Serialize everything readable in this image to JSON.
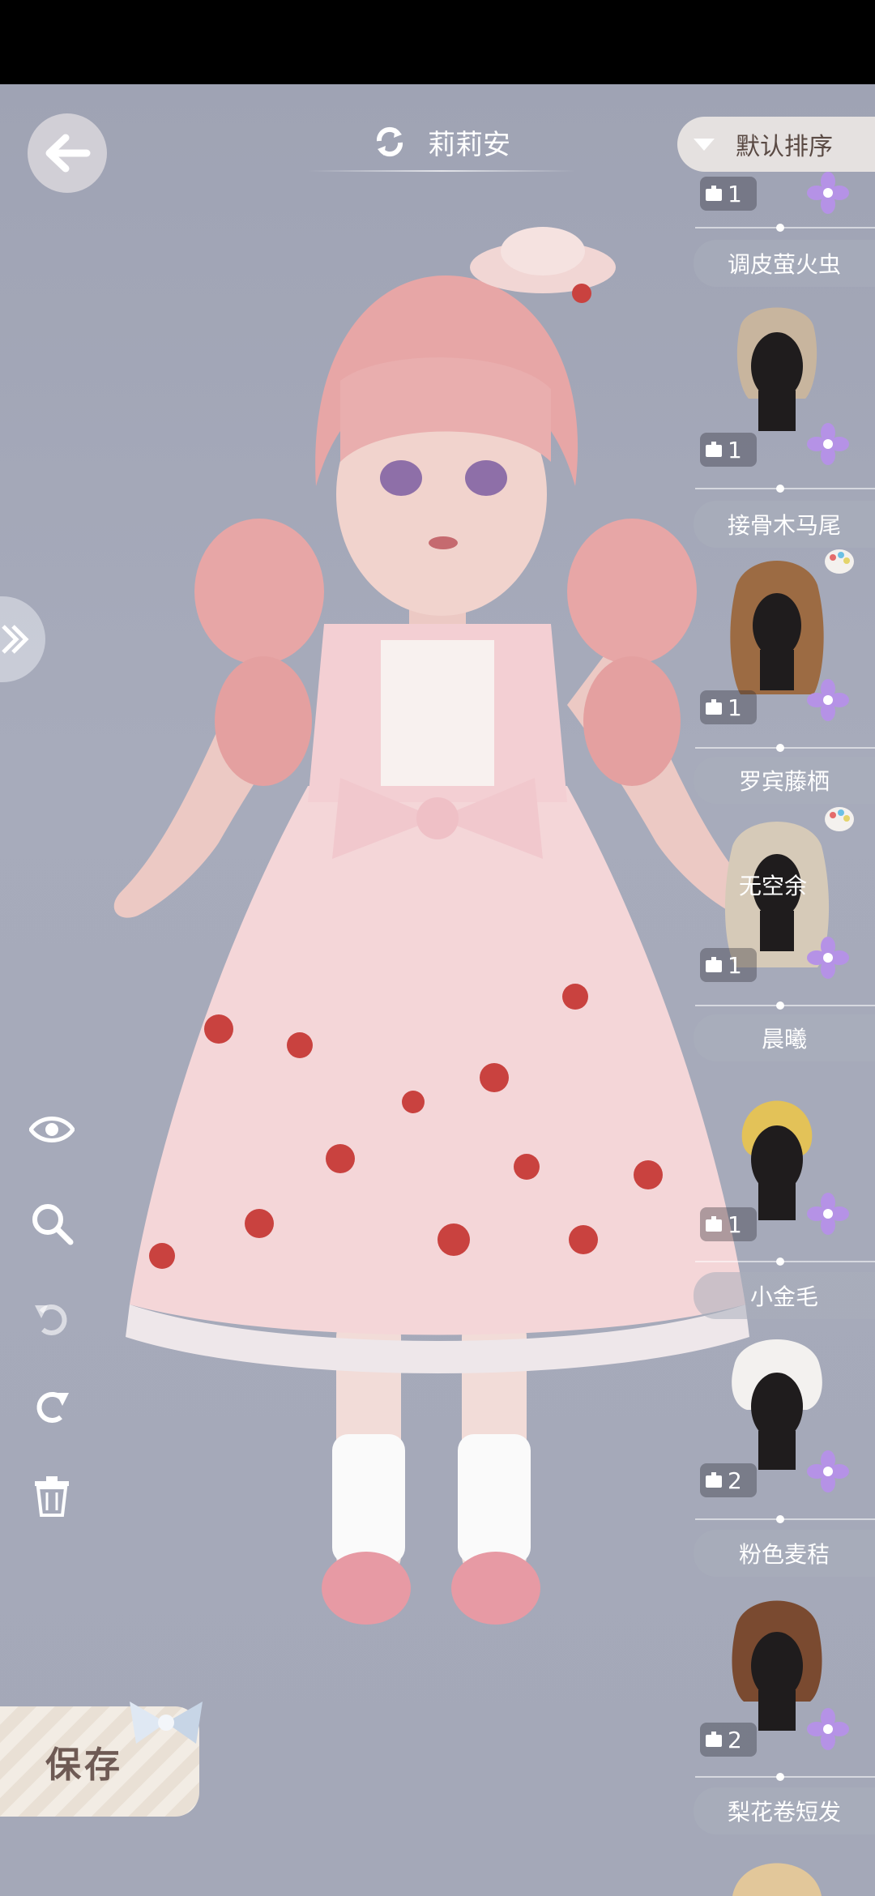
{
  "header": {
    "back_label": "",
    "title": "莉莉安",
    "sort_label": "默认排序"
  },
  "tools": [
    "eye-icon",
    "zoom-icon",
    "undo-icon",
    "redo-icon",
    "delete-icon"
  ],
  "save_label": "保存",
  "character_tag": "无空余",
  "hair_list": [
    {
      "count": "1"
    },
    {
      "name": "调皮萤火虫",
      "count": "1",
      "color": "#c8b59e"
    },
    {
      "name": "接骨木马尾",
      "count": "1",
      "color": "#9c6b43"
    },
    {
      "name": "罗宾藤栖",
      "count": "1",
      "color": "#d6cab8"
    },
    {
      "name": "晨曦",
      "count": "1",
      "color": "#e3c258"
    },
    {
      "name": "小金毛",
      "count": "2",
      "color": "#f3f1ef"
    },
    {
      "name": "粉色麦秸",
      "count": "2",
      "color": "#7a4a30"
    },
    {
      "name": "梨花卷短发"
    }
  ],
  "colors": {
    "accent": "#b592e6",
    "dress": "#f4d6d8",
    "hair": "#e7a6a6"
  }
}
